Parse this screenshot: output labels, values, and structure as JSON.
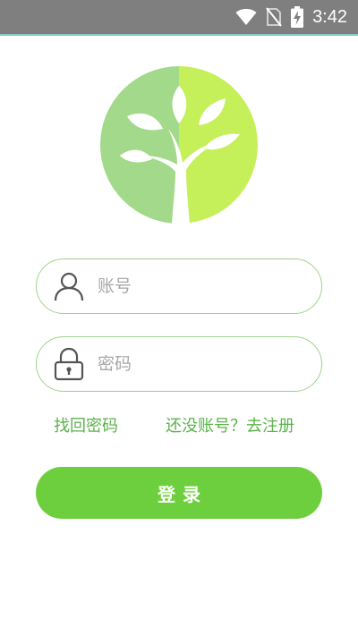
{
  "status_bar": {
    "time": "3:42",
    "icons": [
      "wifi-icon",
      "no-sim-icon",
      "battery-charging-icon"
    ],
    "background": "#7f7f7f"
  },
  "logo": {
    "icon": "tree-logo-icon",
    "colors": [
      "#a3d98a",
      "#c5f05a",
      "#ffffff"
    ]
  },
  "form": {
    "account": {
      "icon": "user-icon",
      "placeholder": "账号",
      "value": ""
    },
    "password": {
      "icon": "lock-icon",
      "placeholder": "密码",
      "value": ""
    }
  },
  "links": {
    "forgot_password": "找回密码",
    "register": "还没账号？去注册"
  },
  "login_button": {
    "label": "登录"
  },
  "colors": {
    "accent": "#6ecf3e",
    "link": "#5bb34a",
    "input_border": "#9fd28b"
  }
}
